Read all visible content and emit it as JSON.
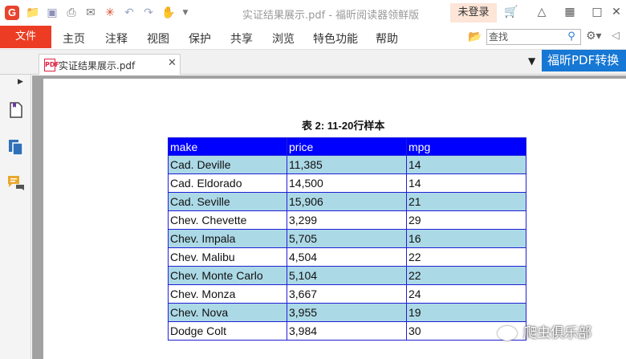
{
  "titlebar": {
    "title": "实证结果展示.pdf - 福昕阅读器领鲜版",
    "login_label": "未登录"
  },
  "menu": {
    "file_label": "文件",
    "items": [
      "主页",
      "注释",
      "视图",
      "保护",
      "共享",
      "浏览",
      "特色功能",
      "帮助"
    ]
  },
  "search": {
    "placeholder": "查找"
  },
  "tab": {
    "label": "实证结果展示.pdf",
    "pdf_badge": "PDF"
  },
  "promo": {
    "text": "福昕PDF转换"
  },
  "document": {
    "table_title": "表 2: 11-20行样本",
    "columns": [
      "make",
      "price",
      "mpg"
    ],
    "rows": [
      [
        "Cad. Deville",
        "11,385",
        "14"
      ],
      [
        "Cad. Eldorado",
        "14,500",
        "14"
      ],
      [
        "Cad. Seville",
        "15,906",
        "21"
      ],
      [
        "Chev. Chevette",
        "3,299",
        "29"
      ],
      [
        "Chev. Impala",
        "5,705",
        "16"
      ],
      [
        "Chev. Malibu",
        "4,504",
        "22"
      ],
      [
        "Chev. Monte Carlo",
        "5,104",
        "22"
      ],
      [
        "Chev. Monza",
        "3,667",
        "24"
      ],
      [
        "Chev. Nova",
        "3,955",
        "19"
      ],
      [
        "Dodge Colt",
        "3,984",
        "30"
      ]
    ]
  },
  "watermark": {
    "text": "爬虫俱乐部"
  },
  "icons": {
    "app_logo": "G",
    "quick_access": [
      "open-folder-icon",
      "save-icon",
      "print-icon",
      "email-icon",
      "new-icon",
      "undo-icon",
      "redo-icon",
      "hand-tool-icon",
      "customize-dropdown-icon"
    ],
    "window_controls": [
      "cart-icon",
      "shirt-icon",
      "grid-icon",
      "minimize-icon",
      "close-window-icon"
    ],
    "sidebar": [
      "bookmark-page-icon",
      "pages-icon",
      "comments-icon"
    ]
  },
  "colors": {
    "brand_red": "#ec3d24",
    "header_blue": "#0000ff",
    "alt_row": "#acd9e6",
    "promo_blue": "#1677d4"
  }
}
